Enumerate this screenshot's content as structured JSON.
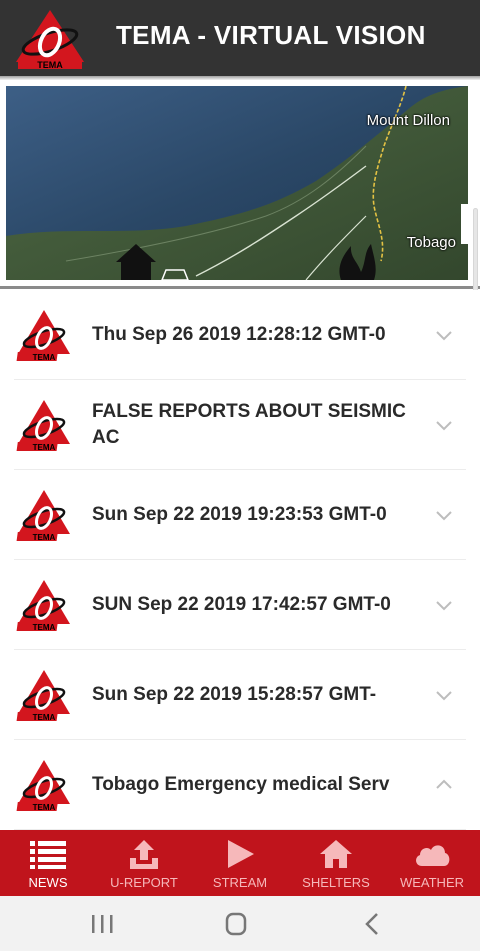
{
  "header": {
    "title": "TEMA - VIRTUAL VISION",
    "logo_icon": "tema-logo-icon"
  },
  "map": {
    "labels": {
      "mount_dillon": "Mount Dillon",
      "tobago": "Tobago"
    }
  },
  "news": {
    "items": [
      {
        "title": "Thu Sep 26 2019 12:28:12 GMT-0",
        "expanded": false
      },
      {
        "title": "FALSE REPORTS ABOUT SEISMIC AC",
        "expanded": false
      },
      {
        "title": "Sun Sep 22 2019 19:23:53 GMT-0",
        "expanded": false
      },
      {
        "title": "SUN Sep 22 2019 17:42:57 GMT-0",
        "expanded": false
      },
      {
        "title": "Sun Sep 22 2019 15:28:57 GMT-",
        "expanded": false
      },
      {
        "title": "Tobago Emergency medical Serv",
        "expanded": true
      }
    ]
  },
  "nav": {
    "items": [
      {
        "label": "NEWS",
        "icon": "news-list-icon",
        "active": true
      },
      {
        "label": "U-REPORT",
        "icon": "upload-icon",
        "active": false
      },
      {
        "label": "STREAM",
        "icon": "play-icon",
        "active": false
      },
      {
        "label": "SHELTERS",
        "icon": "home-icon",
        "active": false
      },
      {
        "label": "WEATHER",
        "icon": "cloud-icon",
        "active": false
      }
    ]
  },
  "colors": {
    "header_bg": "#333333",
    "accent": "#c0141c",
    "nav_inactive": "#f6b8ba"
  }
}
